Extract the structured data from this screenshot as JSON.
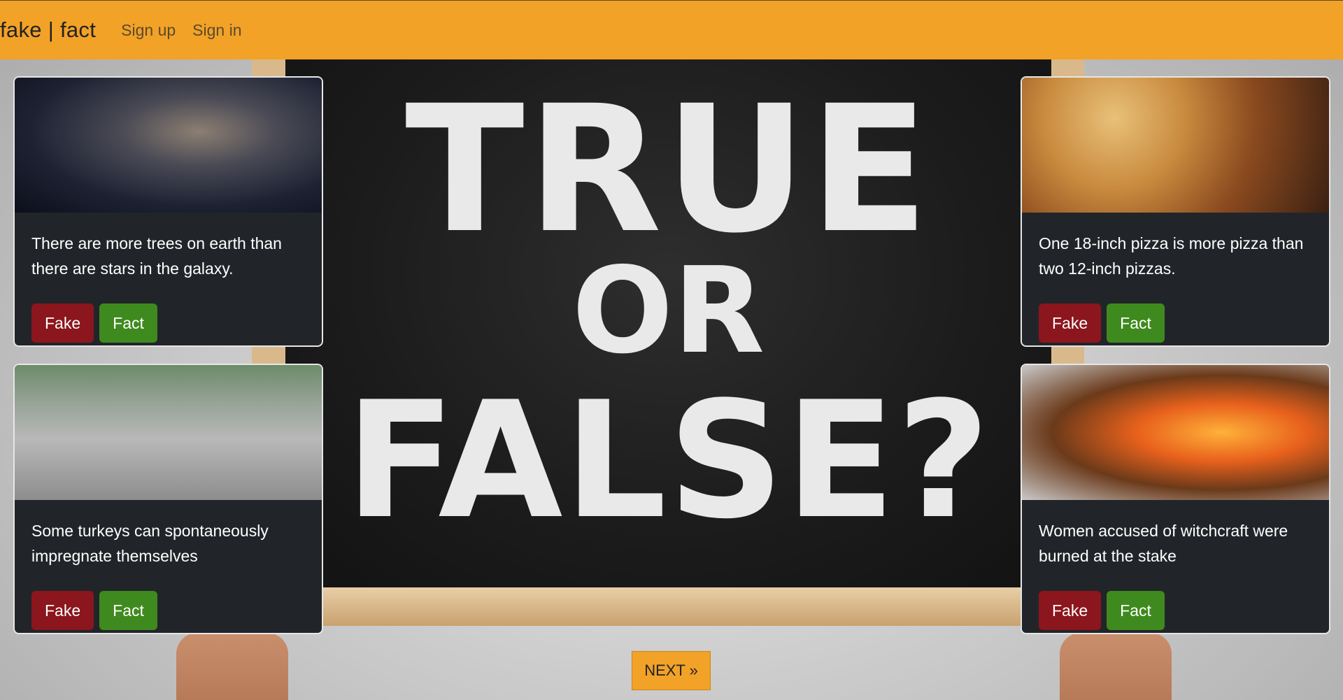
{
  "navbar": {
    "brand": "fake | fact",
    "links": [
      "Sign up",
      "Sign in"
    ]
  },
  "hero": {
    "line1": "TRUE",
    "line2": "OR",
    "line3": "FALSE?"
  },
  "cards": [
    {
      "text": "There are more trees on earth than there are stars in the galaxy.",
      "image": "milky-way-galaxy",
      "fake_label": "Fake",
      "fact_label": "Fact"
    },
    {
      "text": "One 18-inch pizza is more pizza than two 12-inch pizzas.",
      "image": "pizza-slices",
      "fake_label": "Fake",
      "fact_label": "Fact"
    },
    {
      "text": "Some turkeys can spontaneously impregnate themselves",
      "image": "turkey-with-children",
      "fake_label": "Fake",
      "fact_label": "Fact"
    },
    {
      "text": "Women accused of witchcraft were burned at the stake",
      "image": "burning-stake-fire",
      "fake_label": "Fake",
      "fact_label": "Fact"
    }
  ],
  "next_label": "NEXT »",
  "colors": {
    "navbar": "#f2a227",
    "card_bg": "#212529",
    "fake_button": "#8b161d",
    "fact_button": "#3f8a1e",
    "next_button": "#f2a227"
  }
}
